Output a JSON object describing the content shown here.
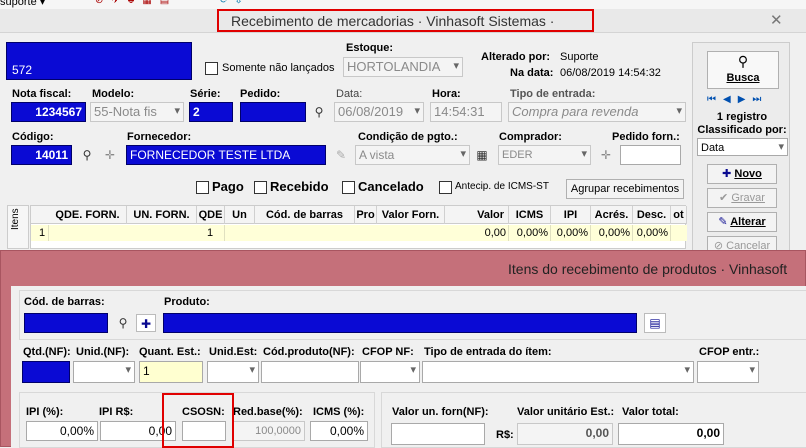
{
  "topbar": {
    "user": "suporte"
  },
  "window1": {
    "title": "Recebimento de mercadorias · Vinhasoft Sistemas ·",
    "record_number": "572",
    "somente_nao_lancados": "Somente não lançados",
    "estoque_label": "Estoque:",
    "estoque_value": "HORTOLANDIA",
    "alterado_por_label": "Alterado por:",
    "alterado_por_value": "Suporte",
    "na_data_label": "Na data:",
    "na_data_value": "06/08/2019 14:54:32",
    "nota_fiscal_label": "Nota fiscal:",
    "nota_fiscal_value": "1234567",
    "modelo_label": "Modelo:",
    "modelo_value": "55-Nota fis",
    "serie_label": "Série:",
    "serie_value": "2",
    "pedido_label": "Pedido:",
    "pedido_value": "",
    "data_label": "Data:",
    "data_value": "06/08/2019",
    "hora_label": "Hora:",
    "hora_value": "14:54:31",
    "tipo_entrada_label": "Tipo de entrada:",
    "tipo_entrada_value": "Compra para revenda",
    "codigo_label": "Código:",
    "codigo_value": "14011",
    "fornecedor_label": "Fornecedor:",
    "fornecedor_value": "FORNECEDOR TESTE LTDA",
    "condicao_label": "Condição de pgto.:",
    "condicao_value": "A vista",
    "comprador_label": "Comprador:",
    "comprador_value": "EDER",
    "pedido_forn_label": "Pedido forn.:",
    "pedido_forn_value": "",
    "pago": "Pago",
    "recebido": "Recebido",
    "cancelado": "Cancelado",
    "antecip": "Antecip. de ICMS-ST",
    "agrupar": "Agrupar recebimentos",
    "itens_tab": "Itens",
    "grid_headers": [
      "QDE. FORN.",
      "UN. FORN.",
      "QDE",
      "Un",
      "Cód. de barras",
      "Pro",
      "Valor Forn.",
      "Valor",
      "ICMS",
      "IPI",
      "Acrés.",
      "Desc.",
      "ot"
    ],
    "grid_row": [
      "",
      "",
      "1",
      "",
      "",
      "",
      "",
      "0,00",
      "0,00%",
      "0,00%",
      "0,00%",
      "0,00%",
      ""
    ],
    "grid_row_index": "1"
  },
  "sidepanel": {
    "busca": "Busca",
    "registros": "1 registro",
    "classificado_por": "Classificado por:",
    "classificado_value": "Data",
    "novo": "Novo",
    "gravar": "Gravar",
    "alterar": "Alterar",
    "cancelar": "Cancelar"
  },
  "window2": {
    "title": "Itens do recebimento de produtos · Vinhasoft",
    "cod_barras_label": "Cód. de barras:",
    "produto_label": "Produto:",
    "qtd_nf_label": "Qtd.(NF):",
    "unid_nf_label": "Unid.(NF):",
    "quant_est_label": "Quant. Est.:",
    "quant_est_value": "1",
    "unid_est_label": "Unid.Est:",
    "cod_produto_nf_label": "Cód.produto(NF):",
    "cfop_nf_label": "CFOP NF:",
    "tipo_entrada_item_label": "Tipo de entrada do ítem:",
    "cfop_entr_label": "CFOP entr.:",
    "ipi_pct_label": "IPI (%):",
    "ipi_pct_value": "0,00%",
    "ipi_rs_label": "IPI R$:",
    "ipi_rs_value": "0,00",
    "csosn_label": "CSOSN:",
    "csosn_value": "",
    "red_base_label": "Red.base(%):",
    "red_base_value": "100,0000",
    "icms_pct_label": "ICMS (%):",
    "icms_pct_value": "0,00%",
    "valor_un_forn_label": "Valor un. forn(NF):",
    "valor_unitario_est_label": "Valor unitário Est.:",
    "valor_unitario_prefix": "R$:",
    "valor_unitario_value": "0,00",
    "valor_total_label": "Valor total:",
    "valor_total_value": "0,00"
  },
  "colors": {
    "accent_blue": "#0a0ad4",
    "window2_title": "#c5707a",
    "highlight": "#e00000"
  }
}
